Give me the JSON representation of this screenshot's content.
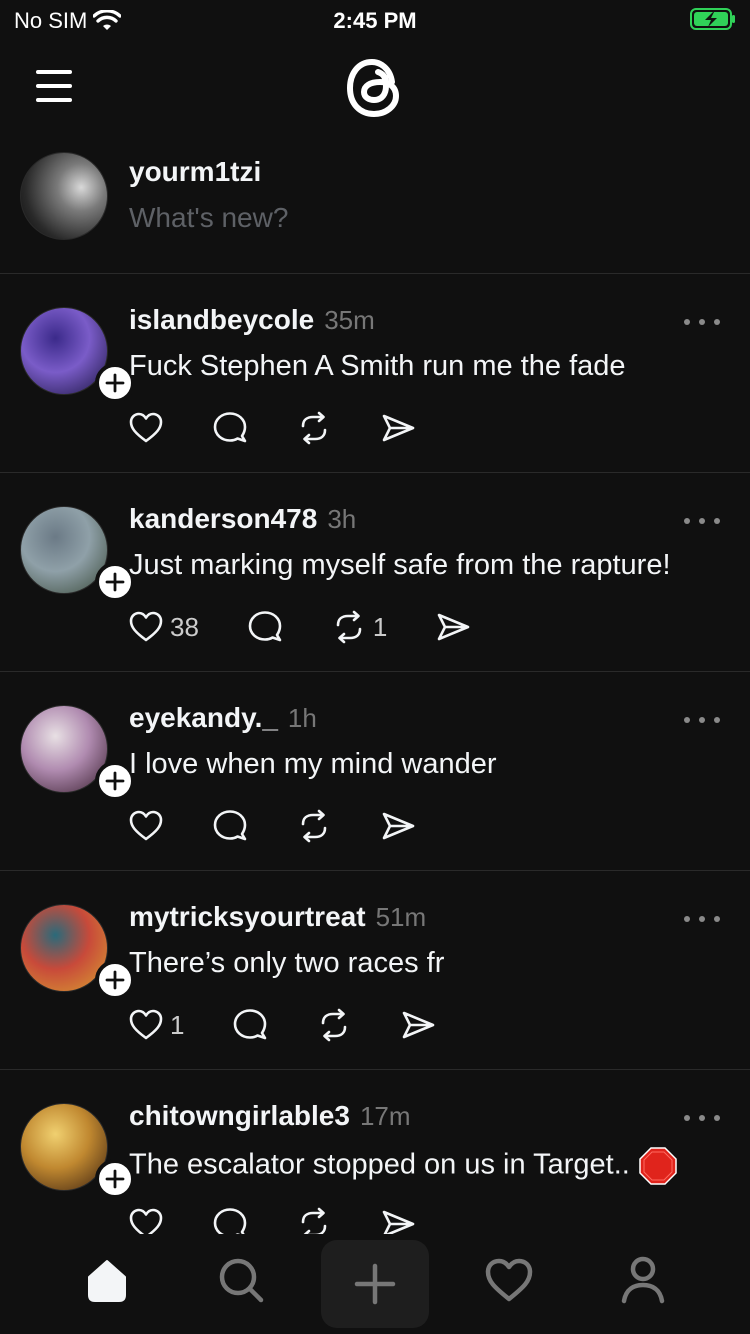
{
  "status_bar": {
    "carrier": "No SIM",
    "time": "2:45 PM",
    "battery_color": "#30d158"
  },
  "header": {
    "logo_icon": "threads-logo",
    "menu_icon": "hamburger-menu-icon"
  },
  "composer": {
    "username": "yourm1tzi",
    "placeholder": "What's new?"
  },
  "posts": [
    {
      "username": "islandbeycole",
      "time": "35m",
      "text": "Fuck Stephen A Smith run me the fade",
      "like_count": "",
      "repost_count": "",
      "avatar_colors": [
        "#3b2a8a",
        "#7a5cc8",
        "#1a1440"
      ]
    },
    {
      "username": "kanderson478",
      "time": "3h",
      "text": "Just marking myself safe from the rapture!",
      "like_count": "38",
      "repost_count": "1",
      "avatar_colors": [
        "#6b7a86",
        "#8fa0a8",
        "#3a4a3a"
      ]
    },
    {
      "username": "eyekandy._",
      "time": "1h",
      "text": "I love when my mind wander",
      "like_count": "",
      "repost_count": "",
      "avatar_colors": [
        "#e8e0e4",
        "#b08bb0",
        "#3a2030"
      ]
    },
    {
      "username": "mytricksyourtreat",
      "time": "51m",
      "text": "There’s only two races fr",
      "like_count": "1",
      "repost_count": "",
      "avatar_colors": [
        "#2a6a7a",
        "#c84a3a",
        "#d8a030"
      ]
    },
    {
      "username": "chitowngirlable3",
      "time": "17m",
      "text": "The escalator stopped on us in Target..",
      "like_count": "",
      "repost_count": "",
      "avatar_colors": [
        "#f0d070",
        "#c08830",
        "#3a2010"
      ],
      "emoji": "stop-sign-emoji"
    }
  ],
  "tabbar": {
    "items": [
      "home-icon",
      "search-icon",
      "create-icon",
      "activity-heart-icon",
      "profile-icon"
    ]
  }
}
